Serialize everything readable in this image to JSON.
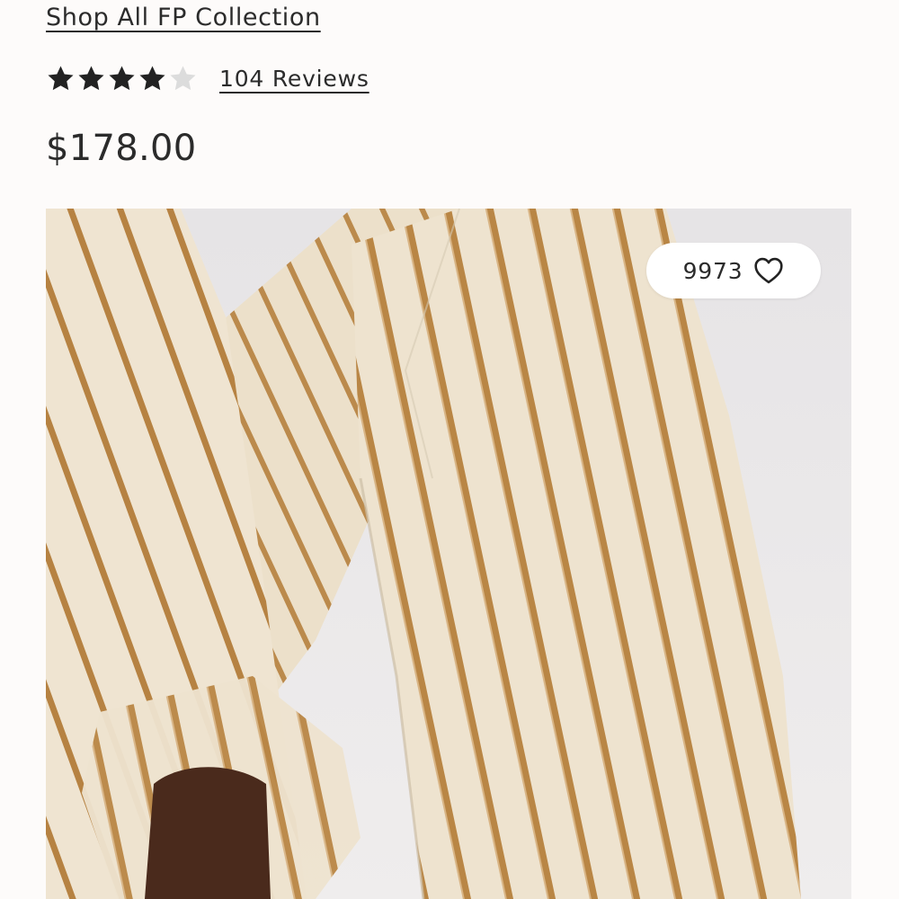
{
  "header": {
    "collection_link": "Shop All FP Collection"
  },
  "rating": {
    "value": 4,
    "max": 5,
    "reviews_label": "104 Reviews",
    "star_filled_color": "#222222",
    "star_empty_color": "#dcdcdc",
    "icon": "star-icon"
  },
  "price": {
    "amount": "$178.00"
  },
  "product_image": {
    "description_icon": "striped-pants-photo",
    "colors": {
      "fabric": "#eee3cf",
      "stripe": "#b98645",
      "background": "#e9e7e8"
    }
  },
  "wishlist": {
    "count": "9973",
    "icon": "heart-icon"
  }
}
